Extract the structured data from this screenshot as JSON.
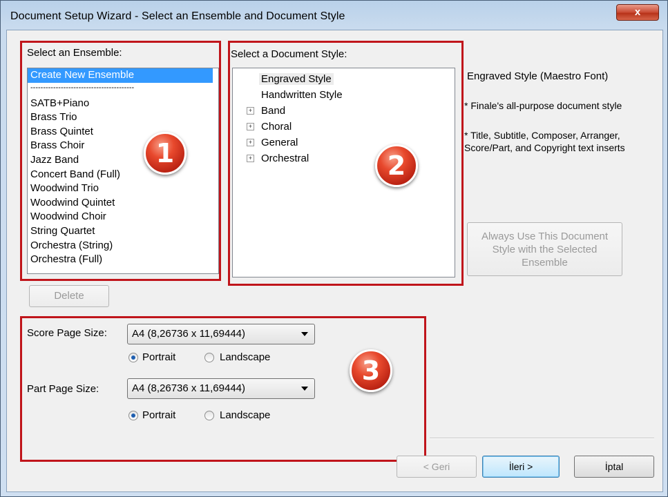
{
  "window": {
    "title": "Document Setup Wizard - Select an Ensemble and Document Style",
    "close_label": "x"
  },
  "ensemble": {
    "label": "Select an Ensemble:",
    "selected": "Create New Ensemble",
    "separator": "-----------------------------------------",
    "items": [
      "SATB+Piano",
      "Brass Trio",
      "Brass Quintet",
      "Brass Choir",
      "Jazz Band",
      "Concert Band (Full)",
      "Woodwind Trio",
      "Woodwind Quintet",
      "Woodwind Choir",
      "String Quartet",
      "Orchestra (String)",
      "Orchestra (Full)"
    ],
    "delete_label": "Delete",
    "badge": "1"
  },
  "style": {
    "label": "Select a Document Style:",
    "items": [
      "Engraved Style",
      "Handwritten Style"
    ],
    "groups": [
      "Band",
      "Choral",
      "General",
      "Orchestral"
    ],
    "expander_glyph": "+",
    "badge": "2"
  },
  "description": {
    "title": "Engraved Style (Maestro Font)",
    "line1": "* Finale's all-purpose document style",
    "line2": "* Title, Subtitle, Composer, Arranger, Score/Part, and Copyright text inserts",
    "always_use_label": "Always Use This Document Style with the Selected Ensemble"
  },
  "page_size": {
    "score_label": "Score Page Size:",
    "score_value": "A4 (8,26736 x 11,69444)",
    "part_label": "Part Page Size:",
    "part_value": "A4 (8,26736 x 11,69444)",
    "portrait_label": "Portrait",
    "landscape_label": "Landscape",
    "score_orientation": "Portrait",
    "part_orientation": "Portrait",
    "badge": "3"
  },
  "footer": {
    "back_label": "< Geri",
    "next_label": "İleri >",
    "cancel_label": "İptal"
  },
  "colors": {
    "highlight": "#c0151b",
    "selection": "#3399ff"
  }
}
